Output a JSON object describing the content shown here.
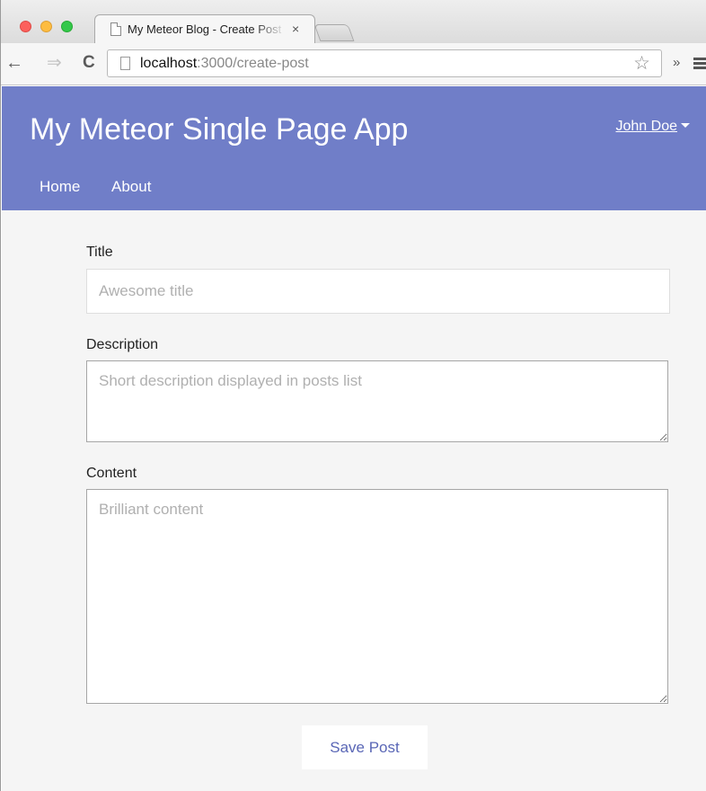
{
  "browser": {
    "tab_title": "My Meteor Blog - Create Post",
    "tab_close": "×",
    "url_host": "localhost",
    "url_path": ":3000/create-post",
    "overflow_label": "»",
    "back_glyph": "←",
    "forward_glyph": "⇒",
    "reload_glyph": "C",
    "star_glyph": "☆"
  },
  "header": {
    "app_title": "My Meteor Single Page App",
    "user_name": "John Doe",
    "nav": [
      {
        "label": "Home"
      },
      {
        "label": "About"
      }
    ],
    "background_color": "#707ec8"
  },
  "form": {
    "title_label": "Title",
    "title_placeholder": "Awesome title",
    "title_value": "",
    "description_label": "Description",
    "description_placeholder": "Short description displayed in posts list",
    "description_value": "",
    "content_label": "Content",
    "content_placeholder": "Brilliant content",
    "content_value": "",
    "save_label": "Save Post"
  },
  "icons": {
    "tab_favicon": "page-icon",
    "omnibox_icon": "page-icon",
    "bookmark": "star-icon",
    "menu": "hamburger-menu-icon",
    "user_caret": "caret-down-icon"
  }
}
